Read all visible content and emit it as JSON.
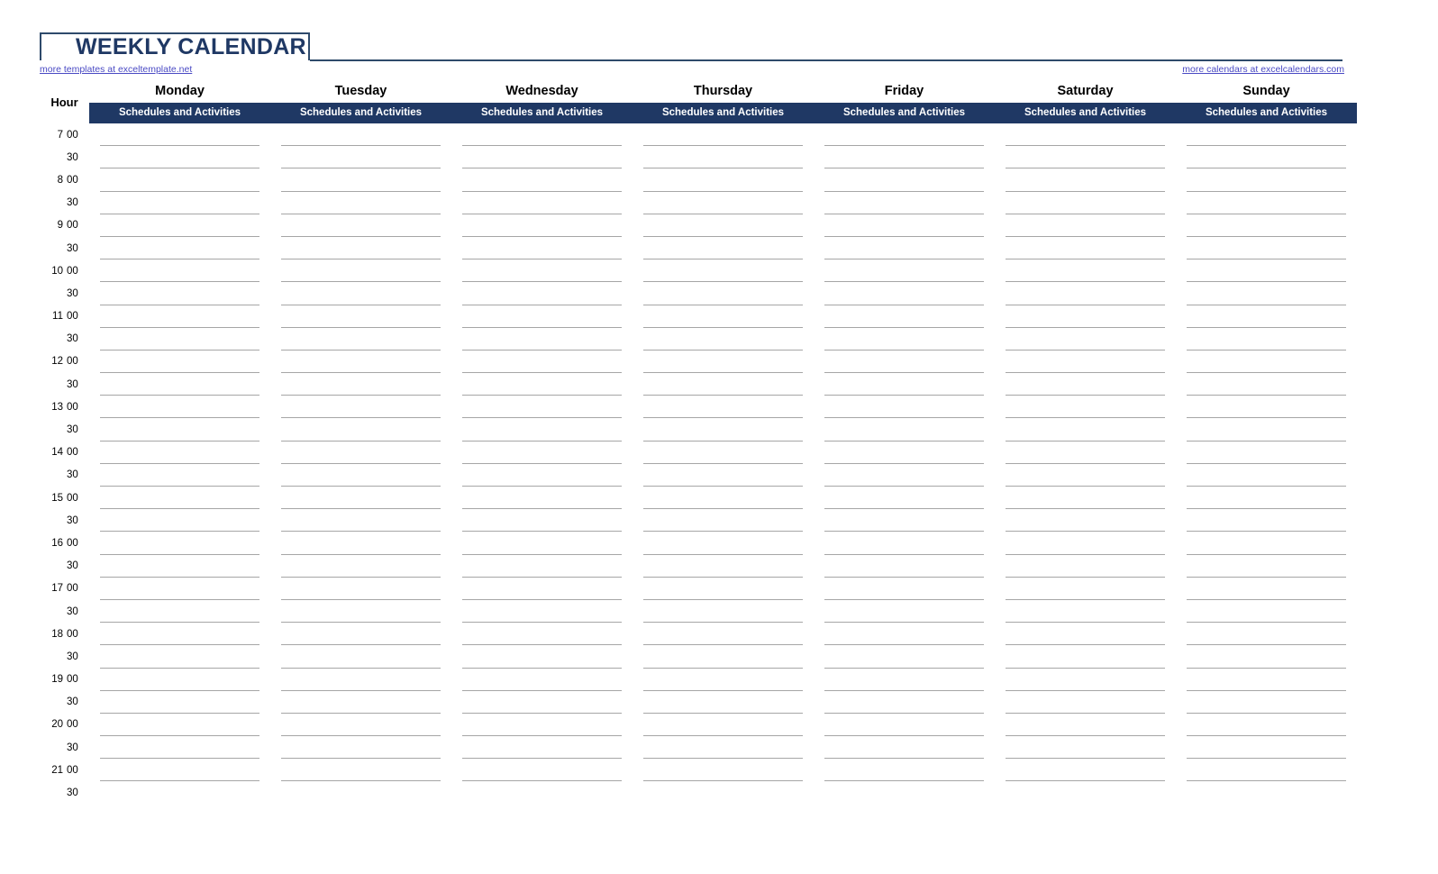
{
  "title": "WEEKLY CALENDAR",
  "links": {
    "left": "more templates at exceltemplate.net",
    "right": "more calendars at excelcalendars.com"
  },
  "colors": {
    "title_text": "#1F3864",
    "title_border": "#2E4A6B",
    "header_band": "#1F3864",
    "header_band_text": "#FFFFFF",
    "link_text": "#4A4AC4",
    "rule_line": "#A6A6A6",
    "grid_line": "#3A3A3A",
    "page_background": "#FFFFFF"
  },
  "table": {
    "hour_header": "Hour",
    "subheader_label": "Schedules and Activities",
    "days": [
      "Monday",
      "Tuesday",
      "Wednesday",
      "Thursday",
      "Friday",
      "Saturday",
      "Sunday"
    ],
    "rows": [
      {
        "hour": "7",
        "minute": "00"
      },
      {
        "hour": "",
        "minute": "30"
      },
      {
        "hour": "8",
        "minute": "00"
      },
      {
        "hour": "",
        "minute": "30"
      },
      {
        "hour": "9",
        "minute": "00"
      },
      {
        "hour": "",
        "minute": "30"
      },
      {
        "hour": "10",
        "minute": "00"
      },
      {
        "hour": "",
        "minute": "30"
      },
      {
        "hour": "11",
        "minute": "00"
      },
      {
        "hour": "",
        "minute": "30"
      },
      {
        "hour": "12",
        "minute": "00"
      },
      {
        "hour": "",
        "minute": "30"
      },
      {
        "hour": "13",
        "minute": "00"
      },
      {
        "hour": "",
        "minute": "30"
      },
      {
        "hour": "14",
        "minute": "00"
      },
      {
        "hour": "",
        "minute": "30"
      },
      {
        "hour": "15",
        "minute": "00"
      },
      {
        "hour": "",
        "minute": "30"
      },
      {
        "hour": "16",
        "minute": "00"
      },
      {
        "hour": "",
        "minute": "30"
      },
      {
        "hour": "17",
        "minute": "00"
      },
      {
        "hour": "",
        "minute": "30"
      },
      {
        "hour": "18",
        "minute": "00"
      },
      {
        "hour": "",
        "minute": "30"
      },
      {
        "hour": "19",
        "minute": "00"
      },
      {
        "hour": "",
        "minute": "30"
      },
      {
        "hour": "20",
        "minute": "00"
      },
      {
        "hour": "",
        "minute": "30"
      },
      {
        "hour": "21",
        "minute": "00"
      },
      {
        "hour": "",
        "minute": "30"
      }
    ]
  }
}
